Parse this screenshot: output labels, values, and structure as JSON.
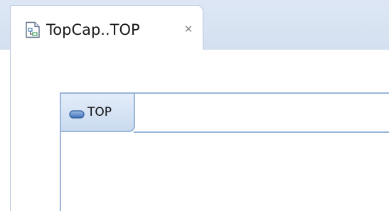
{
  "editor_tab": {
    "title": "TopCap..TOP",
    "icon": "diagram-file-icon",
    "close_icon": "close-icon",
    "close_glyph": "✕"
  },
  "diagram": {
    "frame_label": "TOP",
    "label_icon": "capsule-icon"
  },
  "colors": {
    "tabstrip_background": "#d4e0f0",
    "frame_border": "#9ab6db",
    "label_fill": "#c9daf0"
  }
}
